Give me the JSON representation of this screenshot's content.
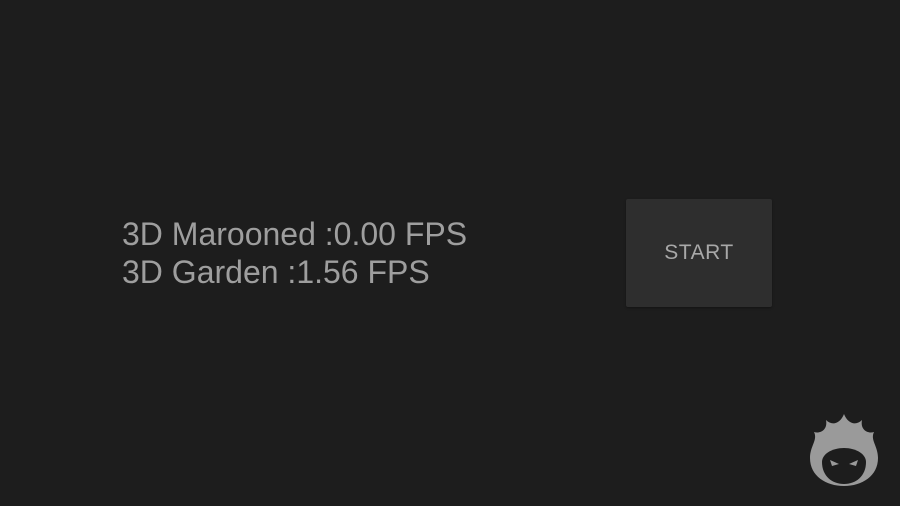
{
  "results": {
    "rows": [
      {
        "label": "3D Marooned :",
        "value": "0.00 FPS"
      },
      {
        "label": "3D Garden :",
        "value": "1.56 FPS"
      }
    ]
  },
  "actions": {
    "start_label": "START"
  },
  "watermark": {
    "icon": "flame-mascot-logo-icon"
  },
  "colors": {
    "background": "#1d1d1d",
    "text": "#9e9e9e",
    "button_bg": "#2e2e2e",
    "logo": "#9a9a9a"
  }
}
